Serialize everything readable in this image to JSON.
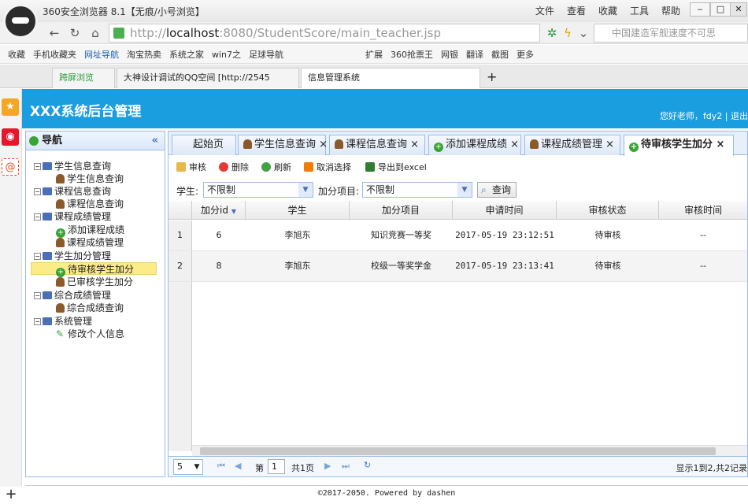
{
  "browser": {
    "window_title": "360安全浏览器 8.1【无痕/小号浏览】",
    "menu": [
      "文件",
      "查看",
      "收藏",
      "工具",
      "帮助"
    ],
    "url_prefix": "http://",
    "url_host": "localhost",
    "url_rest": ":8080/StudentScore/main_teacher.jsp",
    "search_placeholder": "中国建造军舰速度不可思",
    "favorites": [
      "收藏",
      "手机收藏夹",
      "网址导航",
      "淘宝热卖",
      "系统之家",
      "win7之",
      "足球导航"
    ],
    "right_favorites": [
      "扩展",
      "360抢票王",
      "网银",
      "翻译",
      "截图",
      "更多"
    ],
    "tabs": [
      "跨屏浏览",
      "大神设计调试的QQ空间 [http://2545",
      "信息管理系统"
    ]
  },
  "header": {
    "title": "XXX系统后台管理",
    "greeting": "您好老师，fdy2 | 退出"
  },
  "nav": {
    "title": "导航",
    "items": [
      {
        "label": "学生信息查询",
        "level": 0
      },
      {
        "label": "学生信息查询",
        "level": 1
      },
      {
        "label": "课程信息查询",
        "level": 0
      },
      {
        "label": "课程信息查询",
        "level": 1
      },
      {
        "label": "课程成绩管理",
        "level": 0
      },
      {
        "label": "添加课程成绩",
        "level": 1
      },
      {
        "label": "课程成绩管理",
        "level": 1
      },
      {
        "label": "学生加分管理",
        "level": 0
      },
      {
        "label": "待审核学生加分",
        "level": 1
      },
      {
        "label": "已审核学生加分",
        "level": 1
      },
      {
        "label": "综合成绩管理",
        "level": 0
      },
      {
        "label": "综合成绩查询",
        "level": 1
      },
      {
        "label": "系统管理",
        "level": 0
      },
      {
        "label": "修改个人信息",
        "level": 1
      }
    ]
  },
  "content_tabs": [
    "起始页",
    "学生信息查询",
    "课程信息查询",
    "添加课程成绩",
    "课程成绩管理",
    "待审核学生加分"
  ],
  "toolbar": {
    "audit": "审核",
    "delete": "删除",
    "refresh": "刷新",
    "cancel": "取消选择",
    "export": "导出到excel"
  },
  "filter": {
    "student_label": "学生:",
    "student_value": "不限制",
    "item_label": "加分项目:",
    "item_value": "不限制",
    "query": "查询"
  },
  "grid": {
    "columns": [
      "加分id",
      "学生",
      "加分项目",
      "申请时间",
      "审核状态",
      "审核时间"
    ],
    "rows": [
      {
        "no": "1",
        "id": "6",
        "student": "李旭东",
        "item": "知识竞赛一等奖",
        "time": "2017-05-19 23:12:51",
        "status": "待审核",
        "audit_time": "--"
      },
      {
        "no": "2",
        "id": "8",
        "student": "李旭东",
        "item": "校级一等奖学金",
        "time": "2017-05-19 23:13:41",
        "status": "待审核",
        "audit_time": "--"
      }
    ]
  },
  "pager": {
    "page_size": "5",
    "page_label": "第",
    "page": "1",
    "total_pages": "共1页",
    "summary": "显示1到2,共2记录"
  },
  "footer": "©2017-2050. Powered by dashen",
  "colors": {
    "header_bg": "#1b9ee0",
    "panel_border": "#99bbe8",
    "selected": "#fbec88"
  }
}
